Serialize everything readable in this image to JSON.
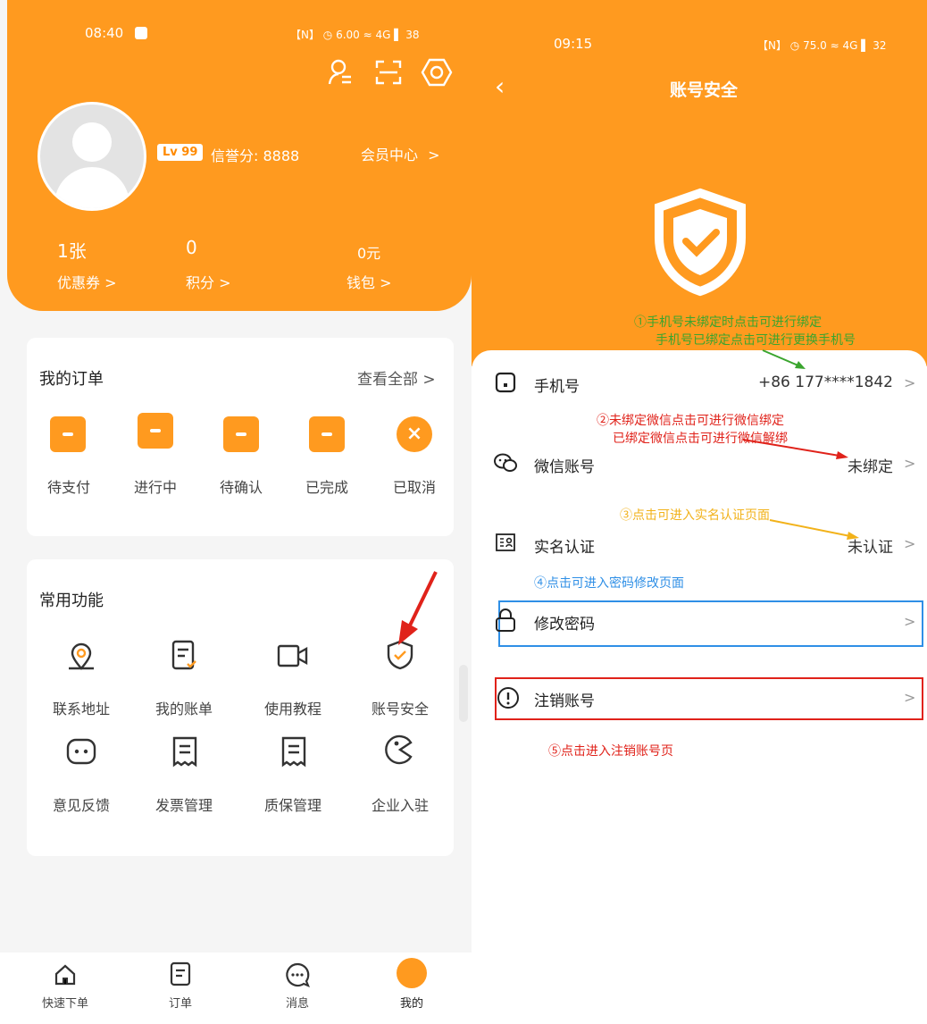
{
  "left": {
    "status": {
      "time": "08:40",
      "right": "【N】 ◷ 6.00 ≈ 4G ▌ 38"
    },
    "level": "Lv 99",
    "credit": "信誉分: 8888",
    "member_center": "会员中心",
    "stats": [
      {
        "value": "1张",
        "label": "优惠券"
      },
      {
        "value": "0",
        "label": "积分"
      },
      {
        "value": "0元",
        "label": "钱包"
      }
    ],
    "orders": {
      "title": "我的订单",
      "view_all": "查看全部",
      "items": [
        "待支付",
        "进行中",
        "待确认",
        "已完成",
        "已取消"
      ]
    },
    "functions": {
      "title": "常用功能",
      "items": [
        "联系地址",
        "我的账单",
        "使用教程",
        "账号安全",
        "意见反馈",
        "发票管理",
        "质保管理",
        "企业入驻"
      ]
    },
    "tabbar": [
      "快速下单",
      "订单",
      "消息",
      "我的"
    ]
  },
  "right": {
    "status": {
      "time": "09:15",
      "right": "【N】 ◷ 75.0 ≈ 4G ▌ 32"
    },
    "title": "账号安全",
    "rows": [
      {
        "label": "手机号",
        "value": "+86 177****1842"
      },
      {
        "label": "微信账号",
        "value": "未绑定"
      },
      {
        "label": "实名认证",
        "value": "未认证"
      },
      {
        "label": "修改密码",
        "value": ""
      },
      {
        "label": "注销账号",
        "value": ""
      }
    ],
    "annotations": {
      "a1_line1": "①手机号未绑定时点击可进行绑定",
      "a1_line2": "手机号已绑定点击可进行更换手机号",
      "a2_line1": "②未绑定微信点击可进行微信绑定",
      "a2_line2": "已绑定微信点击可进行微信解绑",
      "a3": "③点击可进入实名认证页面",
      "a4": "④点击可进入密码修改页面",
      "a5": "⑤点击进入注销账号页"
    },
    "colors": {
      "a1": "#3aa52e",
      "a2": "#e0221a",
      "a3": "#f2b21a",
      "a4": "#2f8fe6",
      "a5": "#e0221a"
    }
  },
  "colors": {
    "brand": "#ff9a1f"
  }
}
